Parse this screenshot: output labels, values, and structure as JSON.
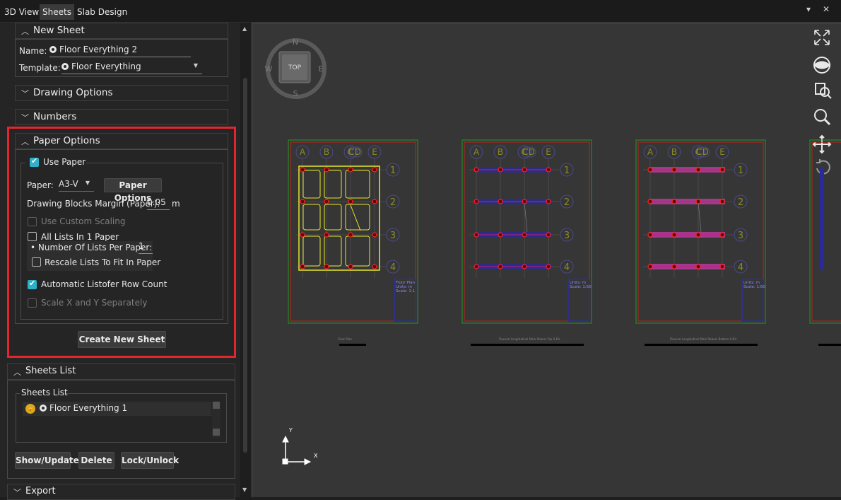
{
  "tabs": [
    "3D View",
    "Sheets",
    "Slab Design"
  ],
  "window_controls": {
    "menu": "▾",
    "close": "✕"
  },
  "new_sheet": {
    "title": "New Sheet",
    "name_label": "Name:",
    "name_value": "Floor Everything 2",
    "template_label": "Template:",
    "template_value": "Floor Everything"
  },
  "drawing_options": {
    "title": "Drawing Options"
  },
  "numbers": {
    "title": "Numbers"
  },
  "paper_options": {
    "title": "Paper Options",
    "use_paper": "Use Paper",
    "paper_label": "Paper:",
    "paper_value": "A3-V",
    "paper_options_button": "Paper Options",
    "margin_label": "Drawing Blocks Margin (Paper):",
    "margin_value": "0.05",
    "margin_unit": "m",
    "use_custom_scaling": "Use Custom Scaling",
    "all_lists": "All Lists In 1 Paper",
    "lists_per_paper_label": "• Number Of Lists Per Paper:",
    "lists_per_paper_value": "1",
    "rescale_lists": "Rescale Lists To Fit In Paper",
    "auto_row_count": "Automatic Listofer Row Count",
    "scale_xy": "Scale X and Y Separately",
    "create_button": "Create New Sheet"
  },
  "sheets_list": {
    "title": "Sheets List",
    "group_label": "Sheets List",
    "items": [
      "Floor Everything 1"
    ],
    "show_update": "Show/Update",
    "delete": "Delete",
    "lock_unlock": "Lock/Unlock"
  },
  "export": {
    "title": "Export"
  },
  "viewcube": {
    "face": "TOP",
    "n": "N",
    "s": "S",
    "e": "E",
    "w": "W"
  },
  "axes": {
    "x": "X",
    "y": "Y"
  },
  "sheets": [
    {
      "col_labels": [
        "A",
        "B",
        "C",
        "D",
        "E"
      ],
      "row_labels": [
        "1",
        "2",
        "3",
        "4"
      ],
      "caption": "Floor Plan",
      "stamp": [
        "Floor Plan",
        "Units: m",
        "Scale: 1:1"
      ]
    },
    {
      "col_labels": [
        "A",
        "B",
        "C",
        "D",
        "E"
      ],
      "row_labels": [
        "1",
        "2",
        "3",
        "4"
      ],
      "caption": "Flexural Longitudinal Main Rebars Top X-Dir",
      "stamp": [
        "Units: m",
        "Scale: 1:60"
      ]
    },
    {
      "col_labels": [
        "A",
        "B",
        "C",
        "D",
        "E"
      ],
      "row_labels": [
        "1",
        "2",
        "3",
        "4"
      ],
      "caption": "Flexural Longitudinal Main Rebars Bottom X-Dir",
      "stamp": [
        "Units: m",
        "Scale: 1:60"
      ]
    }
  ],
  "colors": {
    "highlight": "#e3262e",
    "accent": "#2fb1c9",
    "grid": "#6a6a1a"
  }
}
